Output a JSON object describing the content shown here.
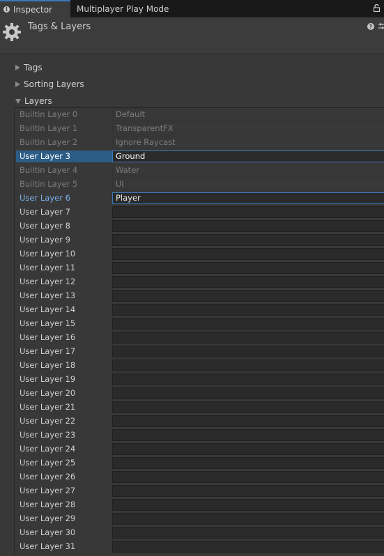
{
  "tabs": {
    "inspector": "Inspector",
    "multiplayer": "Multiplayer Play Mode"
  },
  "header": {
    "title": "Tags & Layers"
  },
  "sections": {
    "tags": "Tags",
    "sorting": "Sorting Layers",
    "layers": "Layers"
  },
  "layers": [
    {
      "label": "Builtin Layer 0",
      "value": "Default",
      "builtin": true
    },
    {
      "label": "Builtin Layer 1",
      "value": "TransparentFX",
      "builtin": true
    },
    {
      "label": "Builtin Layer 2",
      "value": "Ignore Raycast",
      "builtin": true
    },
    {
      "label": "User Layer 3",
      "value": "Ground",
      "selected": true
    },
    {
      "label": "Builtin Layer 4",
      "value": "Water",
      "builtin": true
    },
    {
      "label": "Builtin Layer 5",
      "value": "UI",
      "builtin": true
    },
    {
      "label": "User Layer 6",
      "value": "Player",
      "highlighted": true
    },
    {
      "label": "User Layer 7",
      "value": ""
    },
    {
      "label": "User Layer 8",
      "value": ""
    },
    {
      "label": "User Layer 9",
      "value": ""
    },
    {
      "label": "User Layer 10",
      "value": ""
    },
    {
      "label": "User Layer 11",
      "value": ""
    },
    {
      "label": "User Layer 12",
      "value": ""
    },
    {
      "label": "User Layer 13",
      "value": ""
    },
    {
      "label": "User Layer 14",
      "value": ""
    },
    {
      "label": "User Layer 15",
      "value": ""
    },
    {
      "label": "User Layer 16",
      "value": ""
    },
    {
      "label": "User Layer 17",
      "value": ""
    },
    {
      "label": "User Layer 18",
      "value": ""
    },
    {
      "label": "User Layer 19",
      "value": ""
    },
    {
      "label": "User Layer 20",
      "value": ""
    },
    {
      "label": "User Layer 21",
      "value": ""
    },
    {
      "label": "User Layer 22",
      "value": ""
    },
    {
      "label": "User Layer 23",
      "value": ""
    },
    {
      "label": "User Layer 24",
      "value": ""
    },
    {
      "label": "User Layer 25",
      "value": ""
    },
    {
      "label": "User Layer 26",
      "value": ""
    },
    {
      "label": "User Layer 27",
      "value": ""
    },
    {
      "label": "User Layer 28",
      "value": ""
    },
    {
      "label": "User Layer 29",
      "value": ""
    },
    {
      "label": "User Layer 30",
      "value": ""
    },
    {
      "label": "User Layer 31",
      "value": ""
    }
  ]
}
